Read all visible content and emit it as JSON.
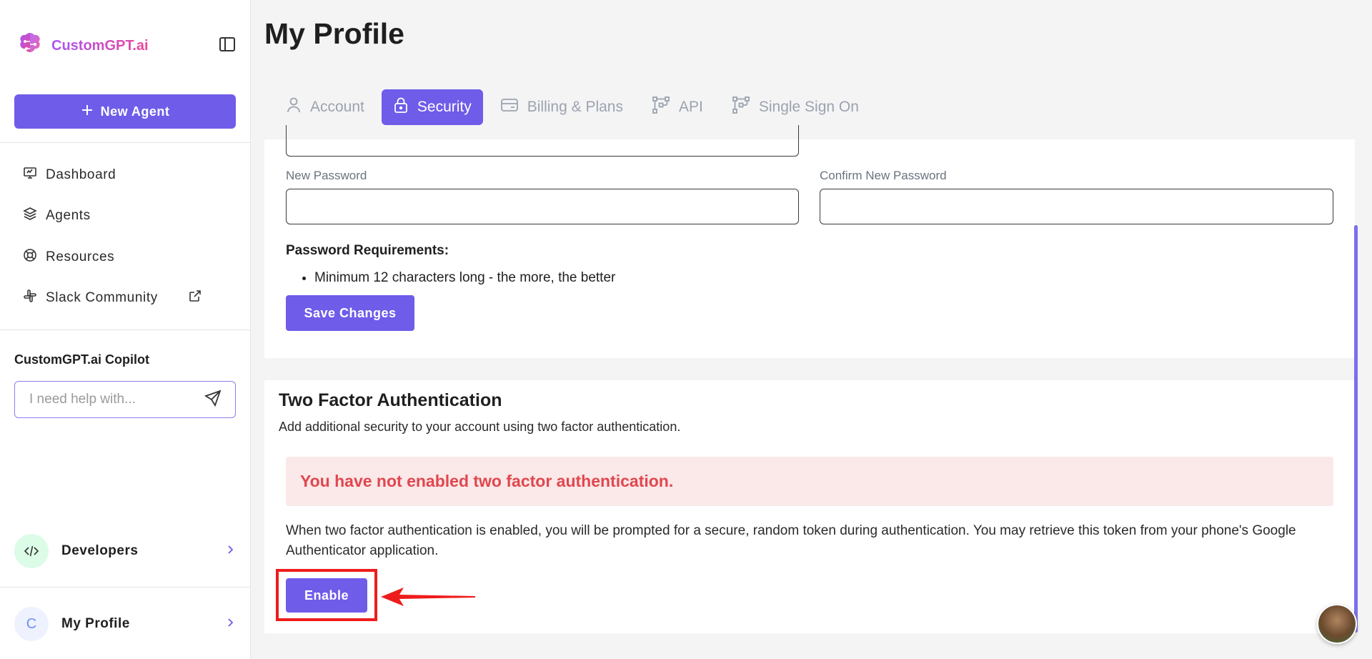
{
  "brand": {
    "name": "CustomGPT.ai"
  },
  "sidebar": {
    "new_agent_label": "New Agent",
    "nav": [
      {
        "label": "Dashboard",
        "icon": "monitor-icon"
      },
      {
        "label": "Agents",
        "icon": "layers-icon"
      },
      {
        "label": "Resources",
        "icon": "lifebuoy-icon"
      },
      {
        "label": "Slack Community",
        "icon": "slack-icon"
      }
    ],
    "copilot": {
      "title": "CustomGPT.ai Copilot",
      "placeholder": "I need help with..."
    },
    "developers_label": "Developers",
    "profile": {
      "initial": "C",
      "label": "My Profile"
    }
  },
  "page": {
    "title": "My Profile",
    "tabs": [
      {
        "label": "Account",
        "active": false
      },
      {
        "label": "Security",
        "active": true
      },
      {
        "label": "Billing & Plans",
        "active": false
      },
      {
        "label": "API",
        "active": false
      },
      {
        "label": "Single Sign On",
        "active": false
      }
    ]
  },
  "password": {
    "new_label": "New Password",
    "confirm_label": "Confirm New Password",
    "requirements_title": "Password Requirements:",
    "requirements": [
      "Minimum 12 characters long - the more, the better"
    ],
    "save_label": "Save Changes"
  },
  "two_factor": {
    "title": "Two Factor Authentication",
    "subtitle": "Add additional security to your account using two factor authentication.",
    "alert": "You have not enabled two factor authentication.",
    "description": "When two factor authentication is enabled, you will be prompted for a secure, random token during authentication. You may retrieve this token from your phone's Google Authenticator application.",
    "enable_label": "Enable"
  },
  "colors": {
    "primary": "#6f5ce9",
    "alert_bg": "#fbe8e8",
    "alert_text": "#e0474f",
    "highlight": "#ee1c1c"
  }
}
